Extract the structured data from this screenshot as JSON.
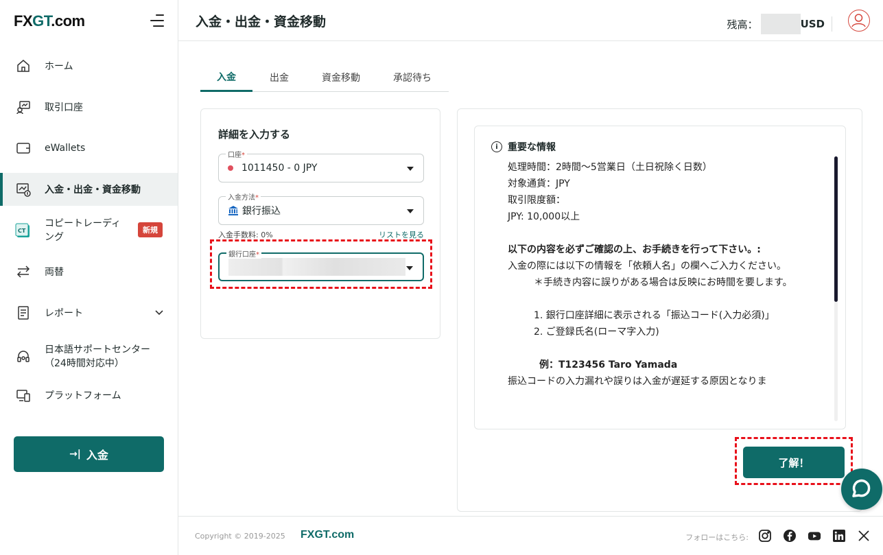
{
  "brand": {
    "logo_prefix": "FX",
    "logo_g": "GT",
    "logo_suffix": ".com"
  },
  "sidebar": {
    "items": [
      {
        "label": "ホーム",
        "icon": "home-icon"
      },
      {
        "label": "取引口座",
        "icon": "trading-account-icon"
      },
      {
        "label": "eWallets",
        "icon": "wallet-icon"
      },
      {
        "label": "入金・出金・資金移動",
        "icon": "deposit-chart-icon",
        "active": true
      },
      {
        "label": "コピートレーディング",
        "icon": "copy-trading-icon",
        "badge": "新規"
      },
      {
        "label": "両替",
        "icon": "exchange-arrows-icon"
      },
      {
        "label": "レポート",
        "icon": "report-document-icon"
      },
      {
        "label": "日本語サポートセンター（24時間対応中）",
        "icon": "headset-icon"
      },
      {
        "label": "プラットフォーム",
        "icon": "platform-devices-icon"
      }
    ],
    "copy_line1": "コピートレーディ",
    "copy_line2": "ング",
    "support_line1": "日本語サポートセンター",
    "support_line2": "（24時間対応中）",
    "deposit_button": "入金"
  },
  "header": {
    "title": "入金・出金・資金移動",
    "balance_label": "残高：",
    "currency": "USD"
  },
  "tabs": [
    {
      "label": "入金",
      "active": true
    },
    {
      "label": "出金"
    },
    {
      "label": "資金移動"
    },
    {
      "label": "承認待ち"
    }
  ],
  "form": {
    "title": "詳細を入力する",
    "account_label": "口座",
    "account_value": "1011450 - 0 JPY",
    "method_label": "入金方法",
    "method_value": "銀行振込",
    "fee_text": "入金手数料: 0%",
    "list_link": "リストを見る",
    "bank_label": "銀行口座",
    "required_mark": "*"
  },
  "info": {
    "heading": "重要な情報",
    "lines": [
      "処理時間：2時間〜5営業日（土日祝除く日数）",
      "対象通貨：JPY",
      "取引限度額：",
      "JPY: 10,000以上"
    ],
    "bold_notice": "以下の内容を必ずご確認の上、お手続きを行って下さい。:",
    "notice_body": "入金の際には以下の情報を「依頼人名」の欄へご入力ください。",
    "warning": "＊手続き内容に誤りがある場合は反映にお時間を要します。",
    "item1": "1. 銀行口座詳細に表示される「振込コード(入力必須)」",
    "item2": "2. ご登録氏名(ローマ字入力)",
    "example": "例：T123456 Taro Yamada",
    "tail": "振込コードの入力漏れや誤りは入金が遅延する原因となりま",
    "ok_button": "了解！"
  },
  "footer": {
    "copyright": "Copyright © 2019-2025",
    "brand": "FXGT.com",
    "follow": "フォローはこちら:"
  },
  "colors": {
    "accent": "#0f6b68",
    "danger": "#d5453b",
    "highlight_dash": "#e8101a"
  }
}
